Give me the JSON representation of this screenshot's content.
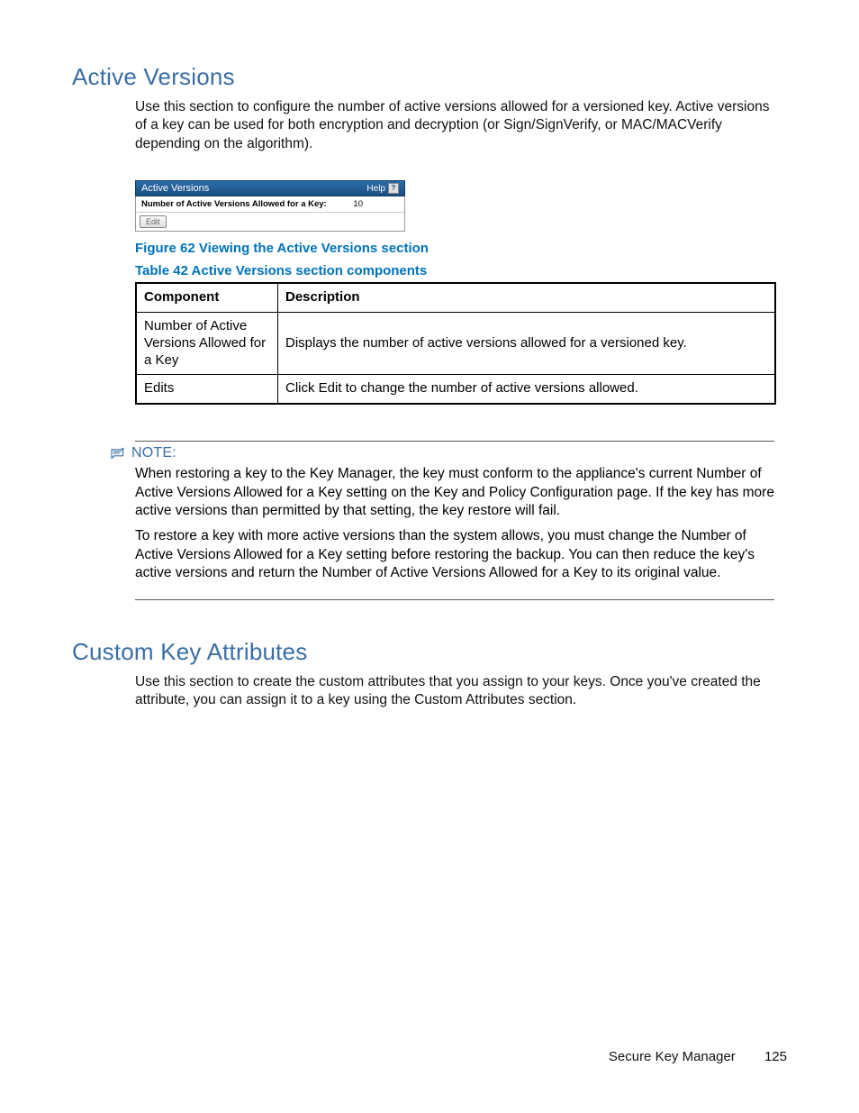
{
  "section1": {
    "heading": "Active Versions",
    "intro": "Use this section to configure the number of active versions allowed for a versioned key. Active versions of a key can be used for both encryption and decryption (or Sign/SignVerify, or MAC/MACVerify depending on the algorithm)."
  },
  "panel": {
    "title": "Active Versions",
    "help_label": "Help",
    "help_glyph": "?",
    "row_label": "Number of Active Versions Allowed for a Key:",
    "row_value": "10",
    "edit_label": "Edit"
  },
  "figure_caption": "Figure 62 Viewing the Active Versions section",
  "table_caption": "Table 42 Active Versions section components",
  "table": {
    "headers": {
      "c1": "Component",
      "c2": "Description"
    },
    "rows": [
      {
        "c1": "Number of Active Versions Allowed for a Key",
        "c2": "Displays the number of active versions allowed for a versioned key."
      },
      {
        "c1": "Edits",
        "c2": "Click Edit to change the number of active versions allowed."
      }
    ]
  },
  "note": {
    "label": "NOTE:",
    "p1": "When restoring a key to the Key Manager, the key must conform to the appliance's current Number of Active Versions Allowed for a Key setting on the Key and Policy Configuration page. If the key has more active versions than permitted by that setting, the key restore will fail.",
    "p2": "To restore a key with more active versions than the system allows, you must change the Number of Active Versions Allowed for a Key setting before restoring the backup. You can then reduce the key's active versions and return the Number of Active Versions Allowed for a Key to its original value."
  },
  "section2": {
    "heading": "Custom Key Attributes",
    "intro": "Use this section to create the custom attributes that you assign to your keys. Once you've created the attribute, you can assign it to a key using the Custom Attributes section."
  },
  "footer": {
    "doc": "Secure Key Manager",
    "page": "125"
  }
}
